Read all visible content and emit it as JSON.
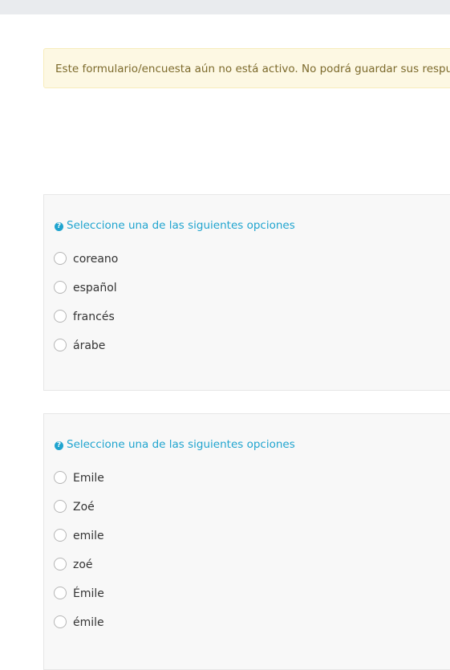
{
  "alert": {
    "text": "Este formulario/encuesta aún no está activo. No podrá guardar sus respuestas."
  },
  "questions": [
    {
      "help": "Seleccione una de las siguientes opciones",
      "options": [
        "coreano",
        "español",
        "francés",
        "árabe"
      ]
    },
    {
      "help": "Seleccione una de las siguientes opciones",
      "options": [
        "Emile",
        "Zoé",
        "emile",
        "zoé",
        "Émile",
        "émile"
      ]
    }
  ]
}
